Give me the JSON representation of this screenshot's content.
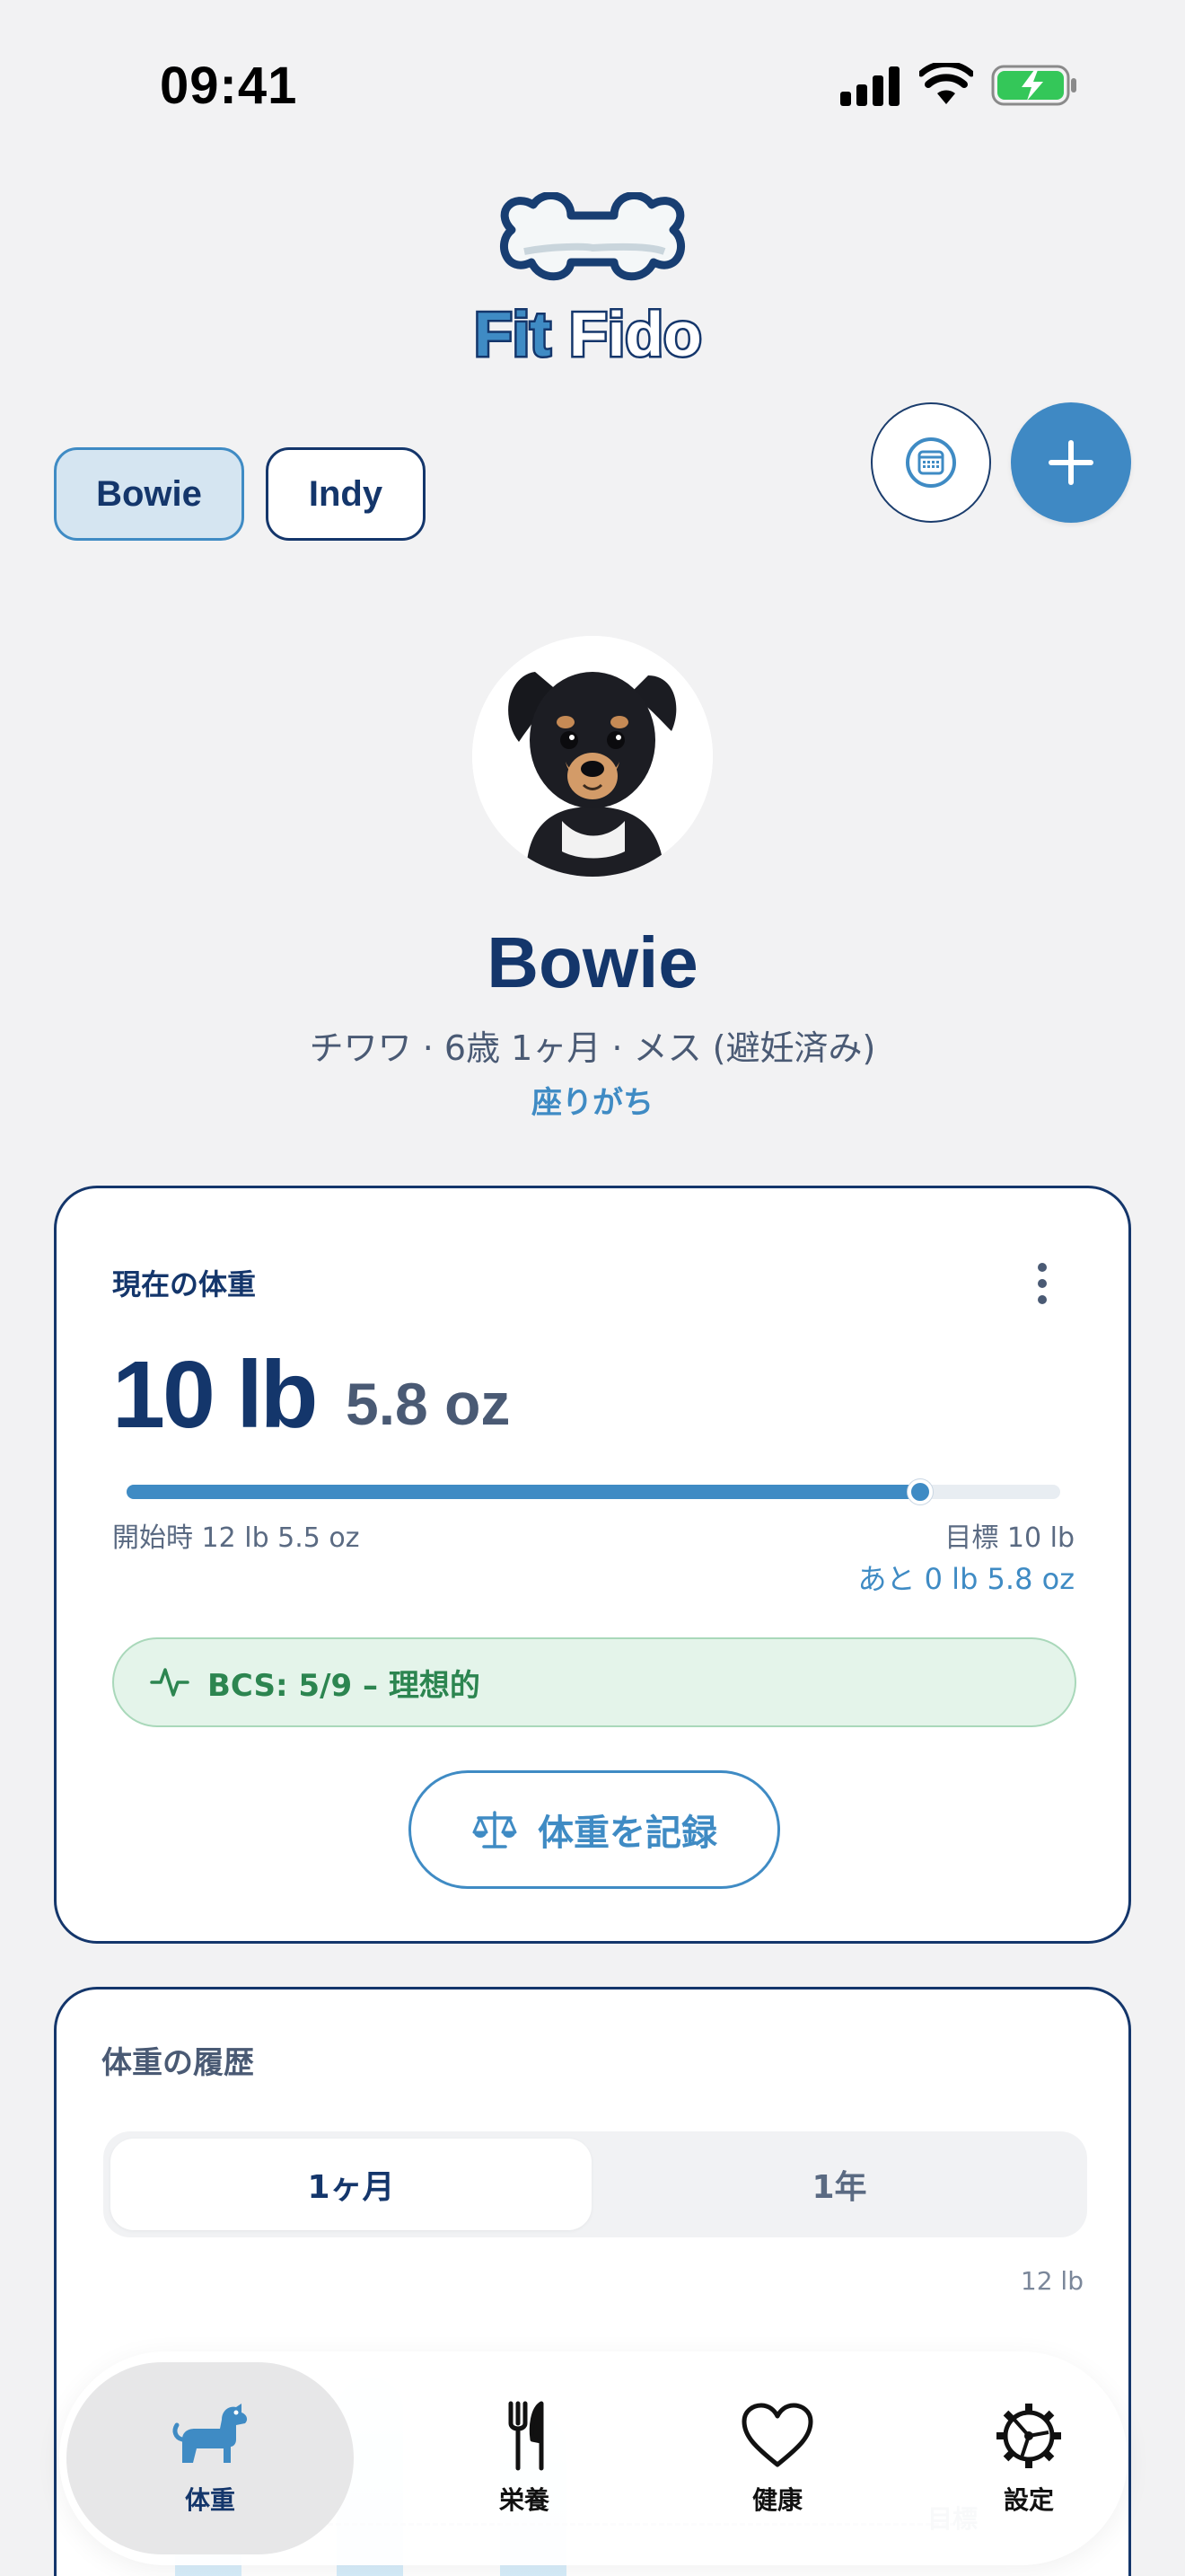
{
  "status_bar": {
    "time": "09:41"
  },
  "app": {
    "name": "FitFido",
    "logo_parts": [
      "Fit",
      "Fido"
    ]
  },
  "pets_tabs": [
    {
      "label": "Bowie",
      "selected": true
    },
    {
      "label": "Indy",
      "selected": false
    }
  ],
  "profile": {
    "name": "Bowie",
    "meta": "チワワ · 6歳 1ヶ月 · メス (避妊済み)",
    "activity": "座りがち"
  },
  "weight_card": {
    "title": "現在の体重",
    "weight_lb": "10 lb",
    "weight_oz": "5.8 oz",
    "progress_fraction": 0.85,
    "start_label": "開始時 12 lb 5.5 oz",
    "goal_label": "目標 10 lb",
    "remaining_label": "あと 0 lb 5.8 oz",
    "bcs_text": "BCS: 5/9 – 理想的",
    "log_button": "体重を記録"
  },
  "history_card": {
    "title": "体重の履歴",
    "segments": [
      {
        "label": "1ヶ月",
        "selected": true
      },
      {
        "label": "1年",
        "selected": false
      }
    ],
    "axis_top_label": "12 lb",
    "goal_line_label": "目標"
  },
  "tab_bar": {
    "items": [
      {
        "label": "体重",
        "icon": "dog-icon",
        "selected": true
      },
      {
        "label": "栄養",
        "icon": "fork-knife-icon",
        "selected": false
      },
      {
        "label": "健康",
        "icon": "heart-icon",
        "selected": false
      },
      {
        "label": "設定",
        "icon": "gear-icon",
        "selected": false
      }
    ]
  },
  "colors": {
    "navy": "#14366b",
    "accent_blue": "#3f8bc4",
    "bcs_green": "#2c8550",
    "background": "#f2f2f3"
  }
}
